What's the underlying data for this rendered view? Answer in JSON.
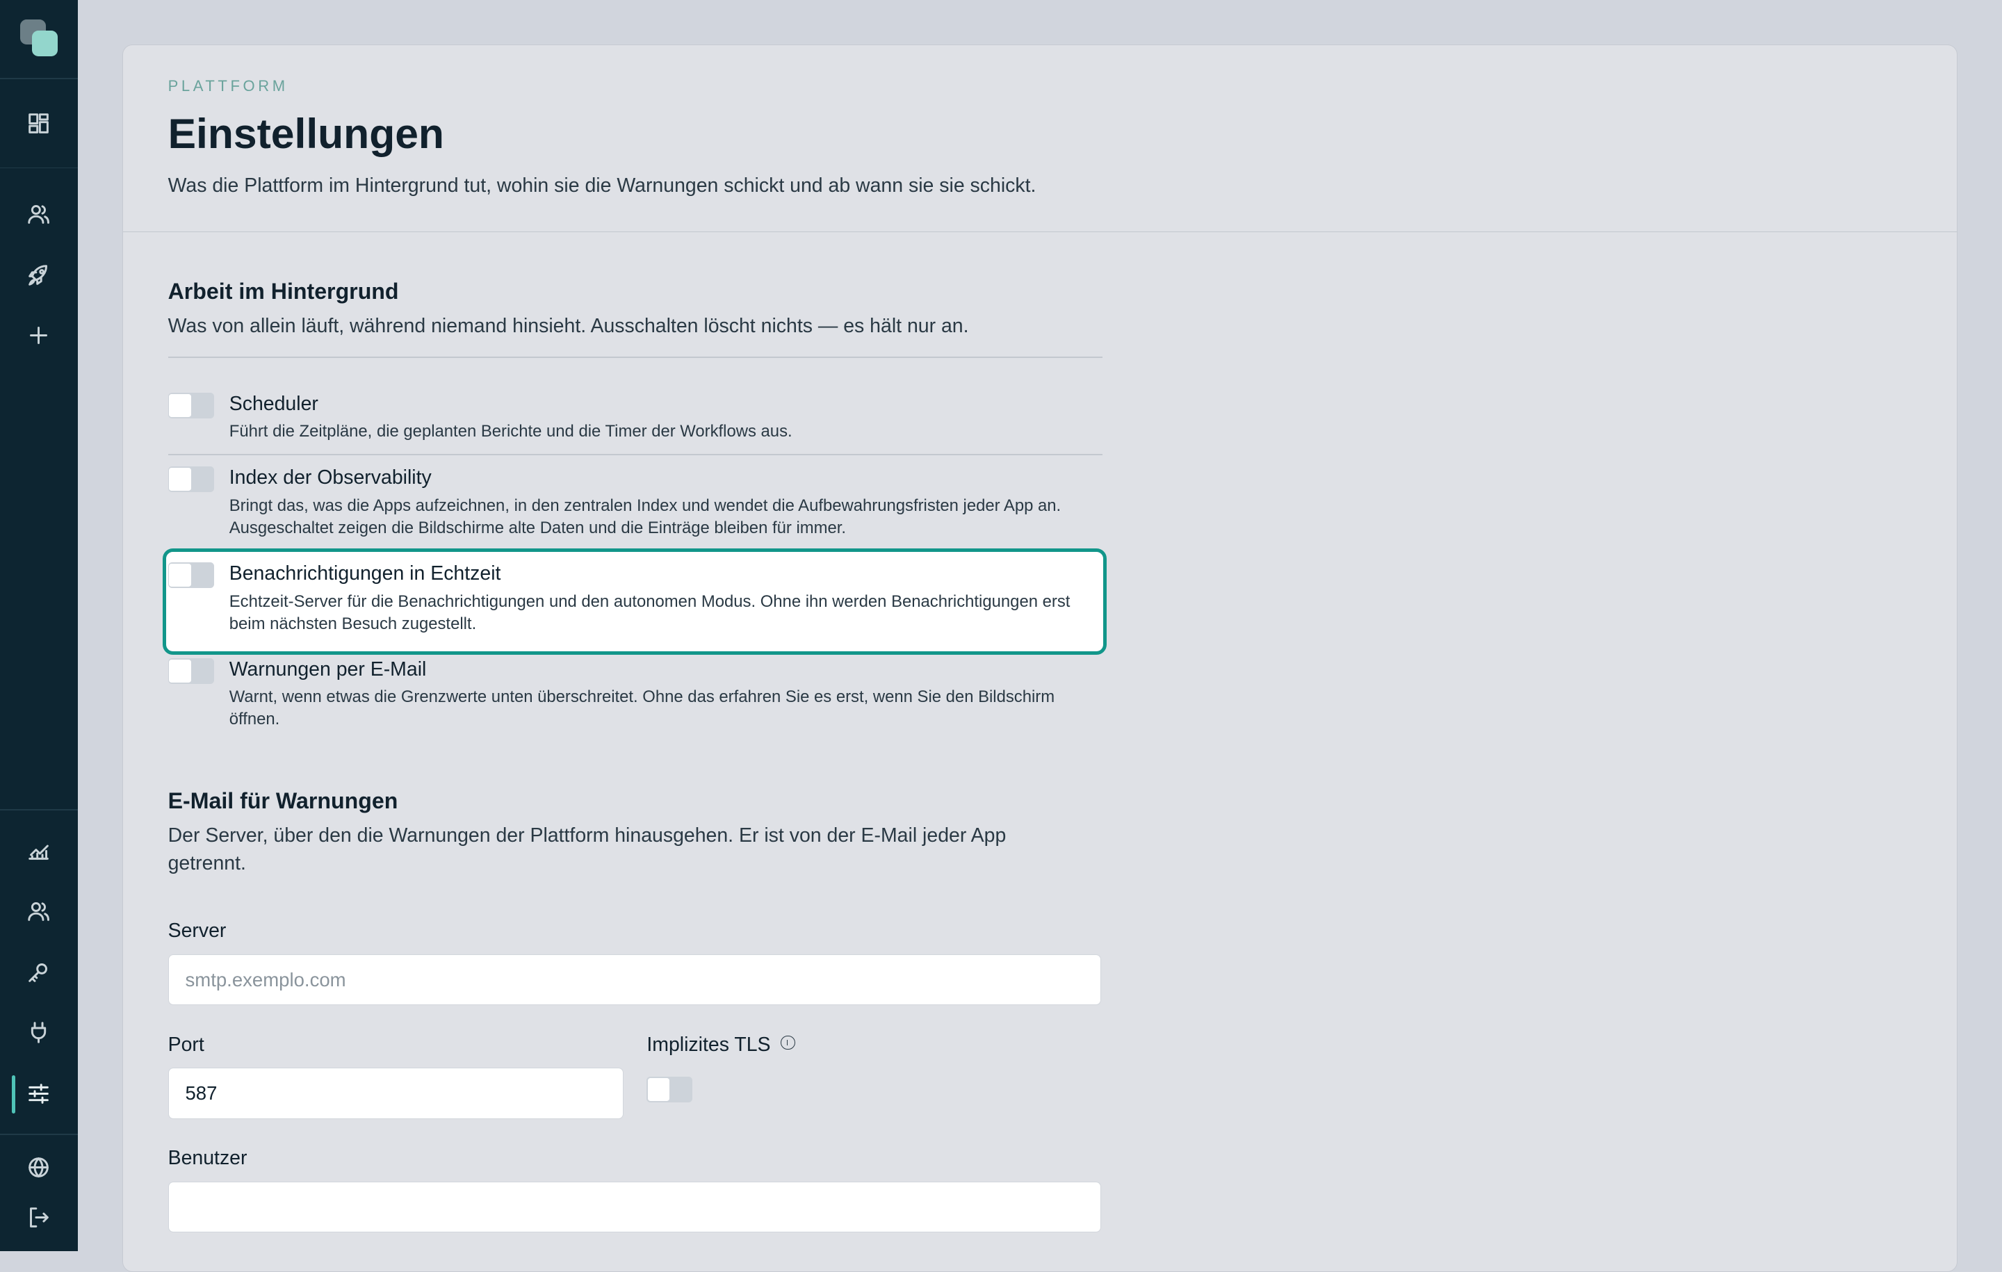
{
  "header": {
    "eyebrow": "PLATTFORM",
    "title": "Einstellungen",
    "subtitle": "Was die Plattform im Hintergrund tut, wohin sie die Warnungen schickt und ab wann sie sie schickt."
  },
  "background": {
    "title": "Arbeit im Hintergrund",
    "description": "Was von allein läuft, während niemand hinsieht. Ausschalten löscht nichts — es hält nur an.",
    "items": [
      {
        "label": "Scheduler",
        "description": "Führt die Zeitpläne, die geplanten Berichte und die Timer der Workflows aus.",
        "enabled": false
      },
      {
        "label": "Index der Observability",
        "description": "Bringt das, was die Apps aufzeichnen, in den zentralen Index und wendet die Aufbewahrungsfristen jeder App an. Ausgeschaltet zeigen die Bildschirme alte Daten und die Einträge bleiben für immer.",
        "enabled": false
      },
      {
        "label": "Benachrichtigungen in Echtzeit",
        "description": "Echtzeit-Server für die Benachrichtigungen und den autonomen Modus. Ohne ihn werden Benachrichtigungen erst beim nächsten Besuch zugestellt.",
        "enabled": false
      },
      {
        "label": "Warnungen per E-Mail",
        "description": "Warnt, wenn etwas die Grenzwerte unten überschreitet. Ohne das erfahren Sie es erst, wenn Sie den Bildschirm öffnen.",
        "enabled": false
      }
    ]
  },
  "email": {
    "title": "E-Mail für Warnungen",
    "description": "Der Server, über den die Warnungen der Plattform hinausgehen. Er ist von der E-Mail jeder App getrennt.",
    "server_label": "Server",
    "server_placeholder": "smtp.exemplo.com",
    "server_value": "",
    "port_label": "Port",
    "port_value": "587",
    "tls_label": "Implizites TLS",
    "tls_enabled": false,
    "user_label": "Benutzer",
    "user_value": ""
  },
  "sidebar": {
    "icons": [
      "dashboard-icon",
      "users-icon",
      "rocket-icon",
      "plus-icon",
      "analytics-icon",
      "team-icon",
      "key-icon",
      "plug-icon",
      "sliders-icon",
      "globe-icon",
      "logout-icon"
    ],
    "active": "sliders-icon"
  },
  "colors": {
    "sidebar": "#0d2531",
    "accent": "#12968a",
    "logo_accent": "#93d6cc"
  }
}
